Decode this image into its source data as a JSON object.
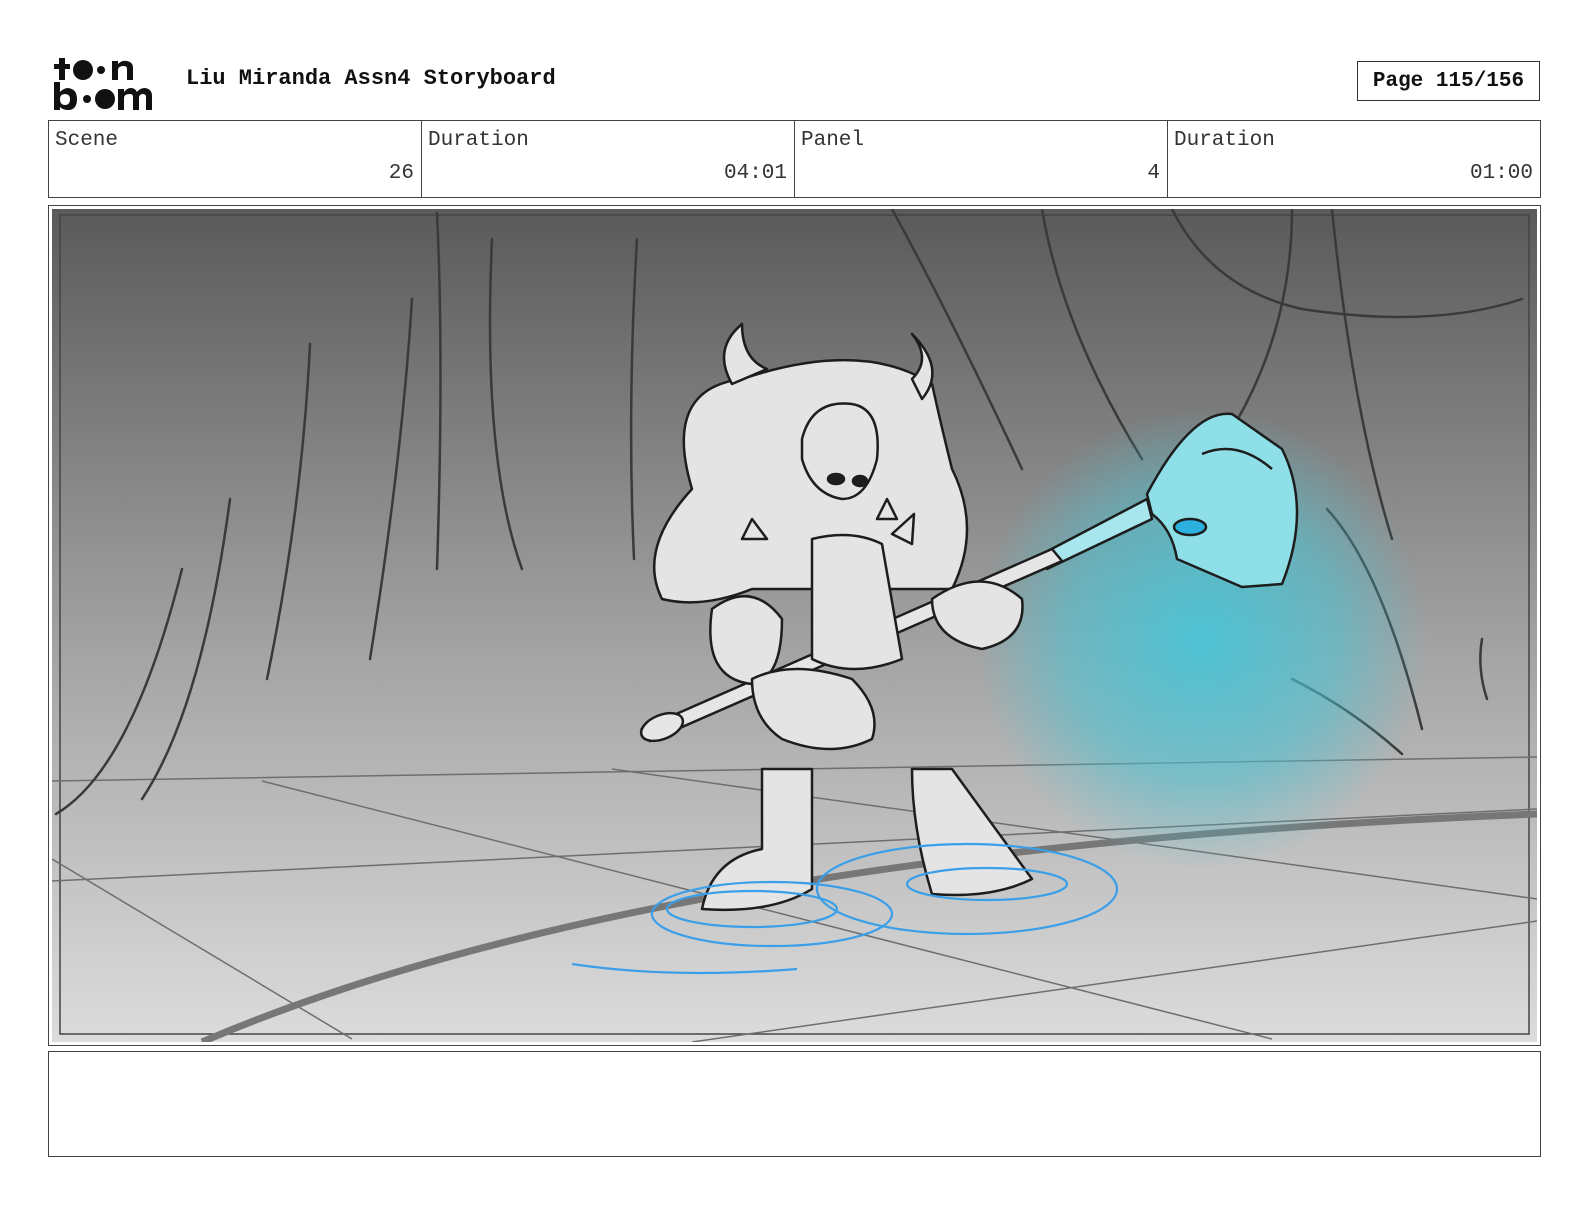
{
  "header": {
    "title": "Liu Miranda Assn4 Storyboard",
    "page": "Page 115/156"
  },
  "info": {
    "scene_label": "Scene",
    "scene_value": "26",
    "scene_duration_label": "Duration",
    "scene_duration_value": "04:01",
    "panel_label": "Panel",
    "panel_value": "4",
    "panel_duration_label": "Duration",
    "panel_duration_value": "01:00"
  },
  "colors": {
    "glow": "#49c4d6",
    "water": "#3a9fe8",
    "sky_top": "#5a5a5a",
    "floor_bottom": "#dcdcdc"
  },
  "icons": [
    "toonboom-logo"
  ]
}
